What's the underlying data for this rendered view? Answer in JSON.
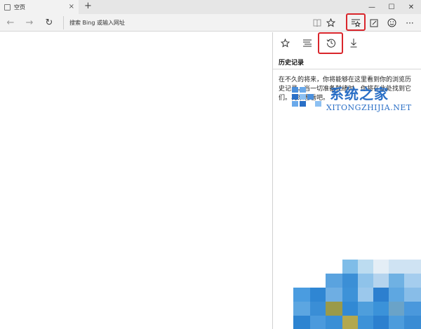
{
  "tab": {
    "title": "空页",
    "close": "×"
  },
  "titlebar": {
    "new_tab": "+",
    "minimize": "—",
    "maximize": "☐",
    "close": "✕"
  },
  "nav": {
    "back": "←",
    "forward": "→",
    "refresh": "↻"
  },
  "address": {
    "placeholder": "搜索 Bing 或输入网址"
  },
  "hub": {
    "title": "历史记录",
    "description": "在不久的将来，你将能够在这里看到你的浏览历史记录。当一切准备就绪时，你将在此处找到它们。再来看看吧。"
  },
  "watermark": {
    "brand": "系统之家",
    "domain": "XITONGZHIJIA.NET"
  },
  "colors": {
    "accent": "#d9262c",
    "watermark": "#2a6fc6"
  }
}
